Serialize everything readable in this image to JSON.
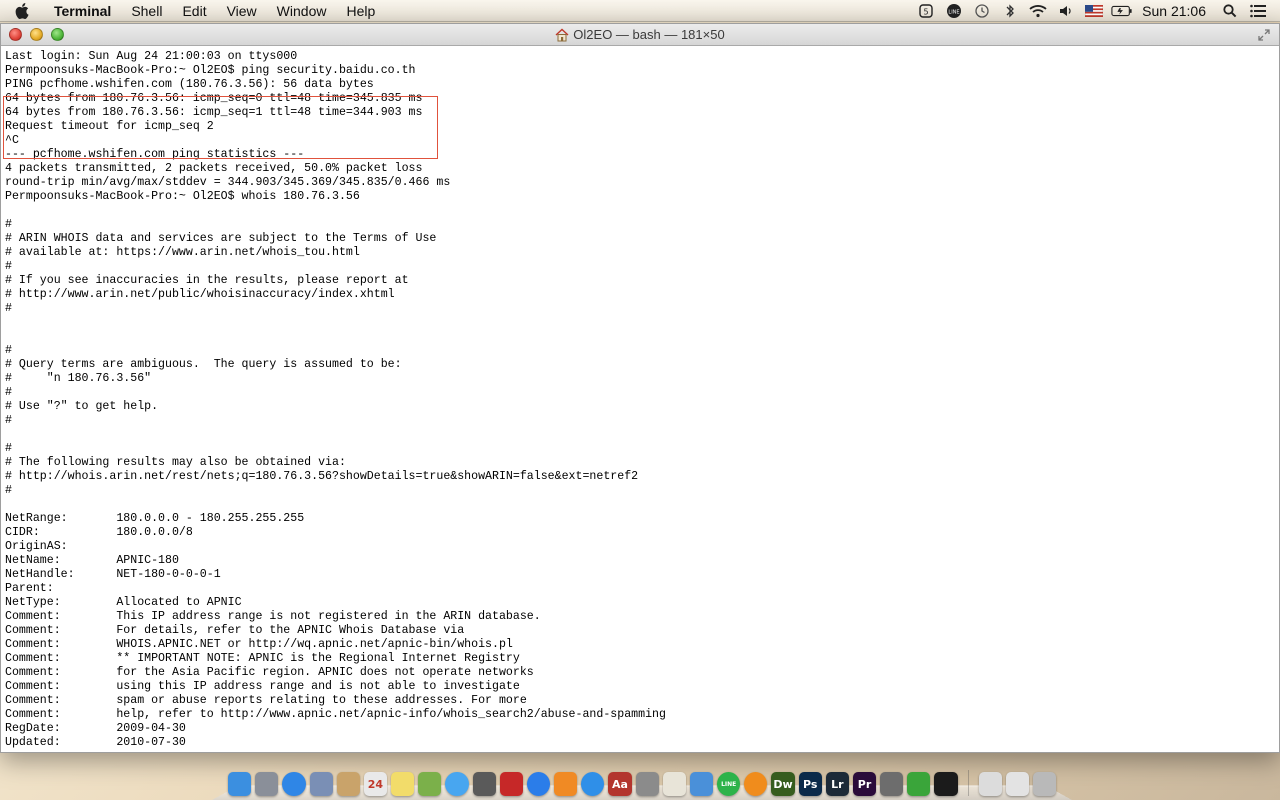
{
  "menubar": {
    "app_name": "Terminal",
    "items": [
      "Shell",
      "Edit",
      "View",
      "Window",
      "Help"
    ],
    "status_icons": [
      "cloud-sync-icon",
      "line-icon",
      "time-machine-icon",
      "bluetooth-icon",
      "wifi-icon",
      "volume-icon",
      "us-flag-icon",
      "battery-icon"
    ],
    "clock": "Sun 21:06"
  },
  "window": {
    "title": "Ol2EO — bash — 181×50"
  },
  "terminal": {
    "lines": [
      "Last login: Sun Aug 24 21:00:03 on ttys000",
      "Permpoonsuks-MacBook-Pro:~ Ol2EO$ ping security.baidu.co.th",
      "PING pcfhome.wshifen.com (180.76.3.56): 56 data bytes",
      "64 bytes from 180.76.3.56: icmp_seq=0 ttl=48 time=345.835 ms",
      "64 bytes from 180.76.3.56: icmp_seq=1 ttl=48 time=344.903 ms",
      "Request timeout for icmp_seq 2",
      "^C",
      "--- pcfhome.wshifen.com ping statistics ---",
      "4 packets transmitted, 2 packets received, 50.0% packet loss",
      "round-trip min/avg/max/stddev = 344.903/345.369/345.835/0.466 ms",
      "Permpoonsuks-MacBook-Pro:~ Ol2EO$ whois 180.76.3.56",
      "",
      "#",
      "# ARIN WHOIS data and services are subject to the Terms of Use",
      "# available at: https://www.arin.net/whois_tou.html",
      "#",
      "# If you see inaccuracies in the results, please report at",
      "# http://www.arin.net/public/whoisinaccuracy/index.xhtml",
      "#",
      "",
      "",
      "#",
      "# Query terms are ambiguous.  The query is assumed to be:",
      "#     \"n 180.76.3.56\"",
      "#",
      "# Use \"?\" to get help.",
      "#",
      "",
      "#",
      "# The following results may also be obtained via:",
      "# http://whois.arin.net/rest/nets;q=180.76.3.56?showDetails=true&showARIN=false&ext=netref2",
      "#",
      "",
      "NetRange:       180.0.0.0 - 180.255.255.255",
      "CIDR:           180.0.0.0/8",
      "OriginAS:",
      "NetName:        APNIC-180",
      "NetHandle:      NET-180-0-0-0-1",
      "Parent:",
      "NetType:        Allocated to APNIC",
      "Comment:        This IP address range is not registered in the ARIN database.",
      "Comment:        For details, refer to the APNIC Whois Database via",
      "Comment:        WHOIS.APNIC.NET or http://wq.apnic.net/apnic-bin/whois.pl",
      "Comment:        ** IMPORTANT NOTE: APNIC is the Regional Internet Registry",
      "Comment:        for the Asia Pacific region. APNIC does not operate networks",
      "Comment:        using this IP address range and is not able to investigate",
      "Comment:        spam or abuse reports relating to these addresses. For more",
      "Comment:        help, refer to http://www.apnic.net/apnic-info/whois_search2/abuse-and-spamming",
      "RegDate:        2009-04-30",
      "Updated:        2010-07-30"
    ]
  },
  "dock": {
    "apps": [
      {
        "name": "finder",
        "label": "",
        "color": "#3b8fe0"
      },
      {
        "name": "launchpad",
        "label": "",
        "color": "#8a8f99"
      },
      {
        "name": "safari",
        "label": "",
        "color": "#2f86e6"
      },
      {
        "name": "preview",
        "label": "",
        "color": "#7a8fb5"
      },
      {
        "name": "contacts",
        "label": "",
        "color": "#c9a36a"
      },
      {
        "name": "calendar",
        "label": "24",
        "color": "#e9e9e9"
      },
      {
        "name": "notes",
        "label": "",
        "color": "#f2dc6a"
      },
      {
        "name": "photos",
        "label": "",
        "color": "#7bb04a"
      },
      {
        "name": "messages",
        "label": "",
        "color": "#48a6f0"
      },
      {
        "name": "facetime",
        "label": "",
        "color": "#5a5a5a"
      },
      {
        "name": "photo-booth",
        "label": "",
        "color": "#c62828"
      },
      {
        "name": "itunes",
        "label": "",
        "color": "#2b7de9"
      },
      {
        "name": "ibooks",
        "label": "",
        "color": "#f08a24"
      },
      {
        "name": "app-store",
        "label": "",
        "color": "#2f8fe8"
      },
      {
        "name": "dictionary",
        "label": "Aa",
        "color": "#b3352d"
      },
      {
        "name": "system-prefs",
        "label": "",
        "color": "#8b8b8b"
      },
      {
        "name": "textedit",
        "label": "",
        "color": "#e8e4d8"
      },
      {
        "name": "keynote",
        "label": "",
        "color": "#4a90d9"
      },
      {
        "name": "line",
        "label": "LINE",
        "color": "#2db34a"
      },
      {
        "name": "vlc",
        "label": "",
        "color": "#f08c1c"
      },
      {
        "name": "dreamweaver",
        "label": "Dw",
        "color": "#365c1e"
      },
      {
        "name": "photoshop",
        "label": "Ps",
        "color": "#0b2a4a"
      },
      {
        "name": "lightroom",
        "label": "Lr",
        "color": "#1c2a38"
      },
      {
        "name": "premiere",
        "label": "Pr",
        "color": "#2a0b3a"
      },
      {
        "name": "image-capture",
        "label": "",
        "color": "#6d6d6d"
      },
      {
        "name": "utorrent",
        "label": "",
        "color": "#3aa53a"
      },
      {
        "name": "terminal",
        "label": "",
        "color": "#1b1b1b"
      },
      {
        "name": "documents",
        "label": "",
        "color": "#dcdcdc"
      },
      {
        "name": "downloads",
        "label": "",
        "color": "#e3e3e3"
      },
      {
        "name": "trash",
        "label": "",
        "color": "#b9b9b9"
      }
    ]
  },
  "colors": {
    "highlight_box": "#e0523c"
  }
}
